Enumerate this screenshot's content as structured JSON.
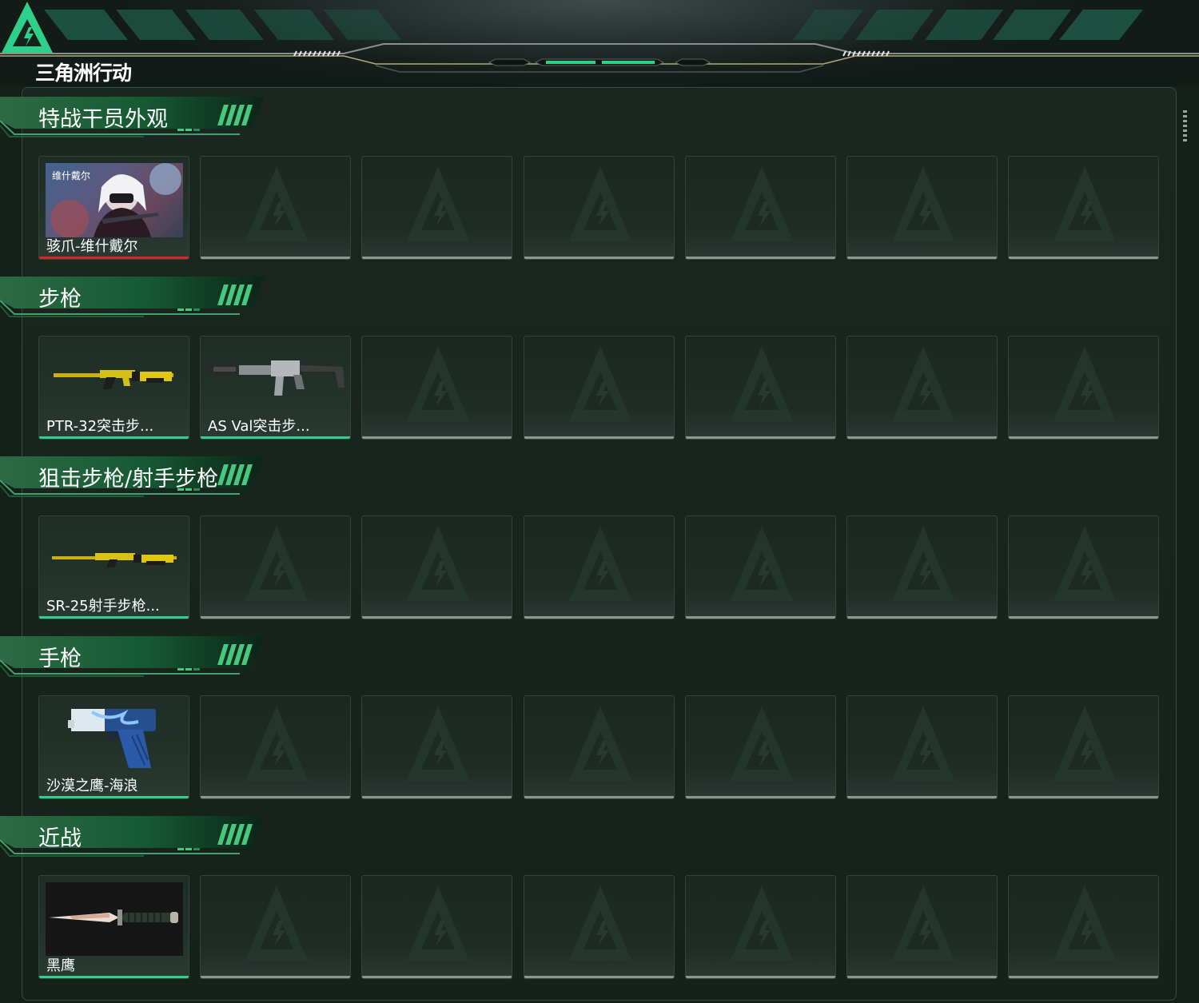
{
  "app": {
    "logo_text": "三角洲行动"
  },
  "colors": {
    "accent": "#2fd18a",
    "rarity_red": "#d62626",
    "panel_bg": "#16211b",
    "empty_underline": "#8f9691"
  },
  "sections": [
    {
      "title": "特战干员外观",
      "items": [
        {
          "name": "骇爪-维什戴尔",
          "icon": "operator-portrait",
          "rarity": "red"
        }
      ]
    },
    {
      "title": "步枪",
      "items": [
        {
          "name": "PTR-32突击步...",
          "icon": "assault-rifle-yellow",
          "rarity": "green"
        },
        {
          "name": "AS Val突击步...",
          "icon": "assault-rifle-grey",
          "rarity": "green"
        }
      ]
    },
    {
      "title": "狙击步枪/射手步枪",
      "items": [
        {
          "name": "SR-25射手步枪...",
          "icon": "marksman-rifle-yellow",
          "rarity": "green"
        }
      ]
    },
    {
      "title": "手枪",
      "items": [
        {
          "name": "沙漠之鹰-海浪",
          "icon": "pistol-blue",
          "rarity": "green"
        }
      ]
    },
    {
      "title": "近战",
      "items": [
        {
          "name": "黑鹰",
          "icon": "knife",
          "rarity": "green"
        }
      ]
    }
  ]
}
